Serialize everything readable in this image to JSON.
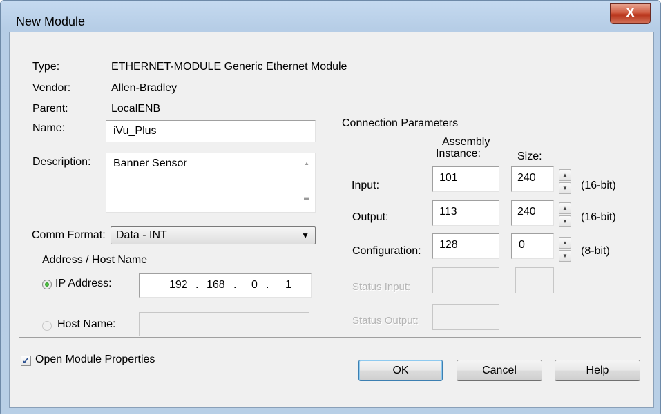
{
  "window": {
    "title": "New Module",
    "close_glyph": "X"
  },
  "info": {
    "type_label": "Type:",
    "type_value": "ETHERNET-MODULE Generic Ethernet Module",
    "vendor_label": "Vendor:",
    "vendor_value": "Allen-Bradley",
    "parent_label": "Parent:",
    "parent_value": "LocalENB",
    "name_label": "Name:",
    "name_value": "iVu_Plus",
    "description_label": "Description:",
    "description_value": "Banner Sensor"
  },
  "comm": {
    "label": "Comm Format:",
    "value": "Data - INT"
  },
  "address": {
    "group_label": "Address / Host Name",
    "ip_label": "IP Address:",
    "ip_octets": [
      "192",
      "168",
      "0",
      "1"
    ],
    "ip_dot": ".",
    "host_label": "Host Name:",
    "host_value": ""
  },
  "connection": {
    "title": "Connection Parameters",
    "assembly_header_line1": "Assembly",
    "assembly_header_line2": "Instance:",
    "size_header": "Size:",
    "rows": [
      {
        "label": "Input:",
        "instance": "101",
        "size": "240",
        "unit": "(16-bit)"
      },
      {
        "label": "Output:",
        "instance": "113",
        "size": "240",
        "unit": "(16-bit)"
      },
      {
        "label": "Configuration:",
        "instance": "128",
        "size": "0",
        "unit": "(8-bit)"
      }
    ],
    "status_input_label": "Status Input:",
    "status_output_label": "Status Output:"
  },
  "open_props": {
    "label": "Open Module Properties",
    "checked": true
  },
  "buttons": {
    "ok": "OK",
    "cancel": "Cancel",
    "help": "Help"
  },
  "icons": {
    "spin_up": "▲",
    "spin_down": "▼",
    "dropdown": "▼",
    "scroll_up": "▲",
    "scroll_down": "▬",
    "check": "✓"
  },
  "colors": {
    "titlebar": "#c5daf0",
    "client": "#f0f0f0",
    "close": "#c7472c",
    "radio_on": "#2f9a26"
  }
}
